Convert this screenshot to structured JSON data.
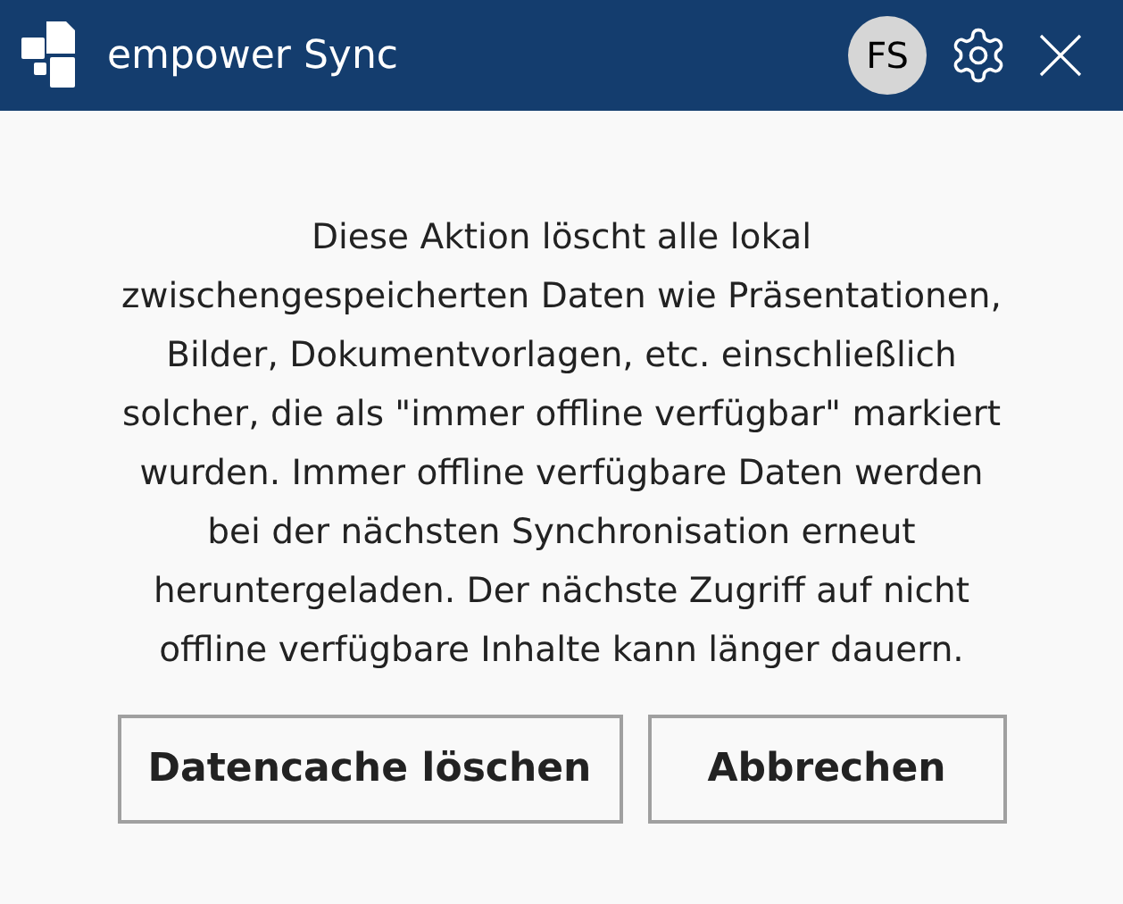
{
  "window": {
    "title": "empower Sync",
    "avatar": "FS"
  },
  "message": "Diese Aktion löscht alle lokal zwischengespeicherten Daten wie Präsentationen, Bilder, Dokumentvorlagen, etc. einschließlich solcher, die als \"immer offline verfügbar\" markiert wurden. Immer offline verfügbare Daten werden bei der nächsten Synchronisation erneut heruntergeladen. Der nächste Zugriff auf nicht offline verfügbare Inhalte kann länger dauern.",
  "buttons": [
    "Datencache löschen",
    "Abbrechen"
  ]
}
